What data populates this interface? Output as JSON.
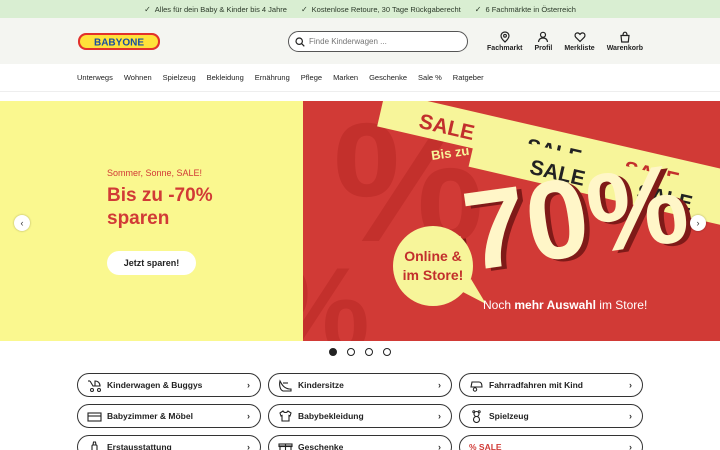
{
  "usp": [
    "Alles für dein Baby & Kinder bis 4 Jahre",
    "Kostenlose Retoure, 30 Tage Rückgaberecht",
    "6 Fachmärkte in Österreich"
  ],
  "logo": {
    "text": "BABYONE"
  },
  "search": {
    "placeholder": "Finde Kinderwagen ..."
  },
  "header_actions": {
    "store": "Fachmarkt",
    "profile": "Profil",
    "wishlist": "Merkliste",
    "cart": "Warenkorb"
  },
  "nav": [
    "Unterwegs",
    "Wohnen",
    "Spielzeug",
    "Bekleidung",
    "Ernährung",
    "Pflege",
    "Marken",
    "Geschenke",
    "Sale %",
    "Ratgeber"
  ],
  "hero": {
    "kicker": "Sommer, Sonne, SALE!",
    "title": "Bis zu -70% sparen",
    "button": "Jetzt sparen!",
    "banner": {
      "sale_word": "SALE",
      "bis_zu": "Bis zu",
      "percent": "-70%",
      "bubble_line1": "Online &",
      "bubble_line2": "im Store!",
      "tagline_pre": "Noch",
      "tagline_bold": "mehr Auswahl",
      "tagline_post": "im Store!"
    }
  },
  "slider_dots": {
    "count": 4,
    "active": 0
  },
  "categories": [
    {
      "label": "Kinderwagen & Buggys",
      "icon": "stroller-icon"
    },
    {
      "label": "Kindersitze",
      "icon": "car-seat-icon"
    },
    {
      "label": "Fahrradfahren mit Kind",
      "icon": "bike-trailer-icon"
    },
    {
      "label": "Babyzimmer & Möbel",
      "icon": "crib-icon"
    },
    {
      "label": "Babybekleidung",
      "icon": "onesie-icon"
    },
    {
      "label": "Spielzeug",
      "icon": "teddy-icon"
    },
    {
      "label": "Erstausstattung",
      "icon": "bottle-icon"
    },
    {
      "label": "Geschenke",
      "icon": "gift-icon"
    },
    {
      "label": "% SALE",
      "icon": ""
    }
  ],
  "colors": {
    "usp_bg": "#d9eed2",
    "hero_yellow": "#faf88f",
    "hero_red": "#d13a36",
    "sale_yellow": "#f7f59a"
  }
}
